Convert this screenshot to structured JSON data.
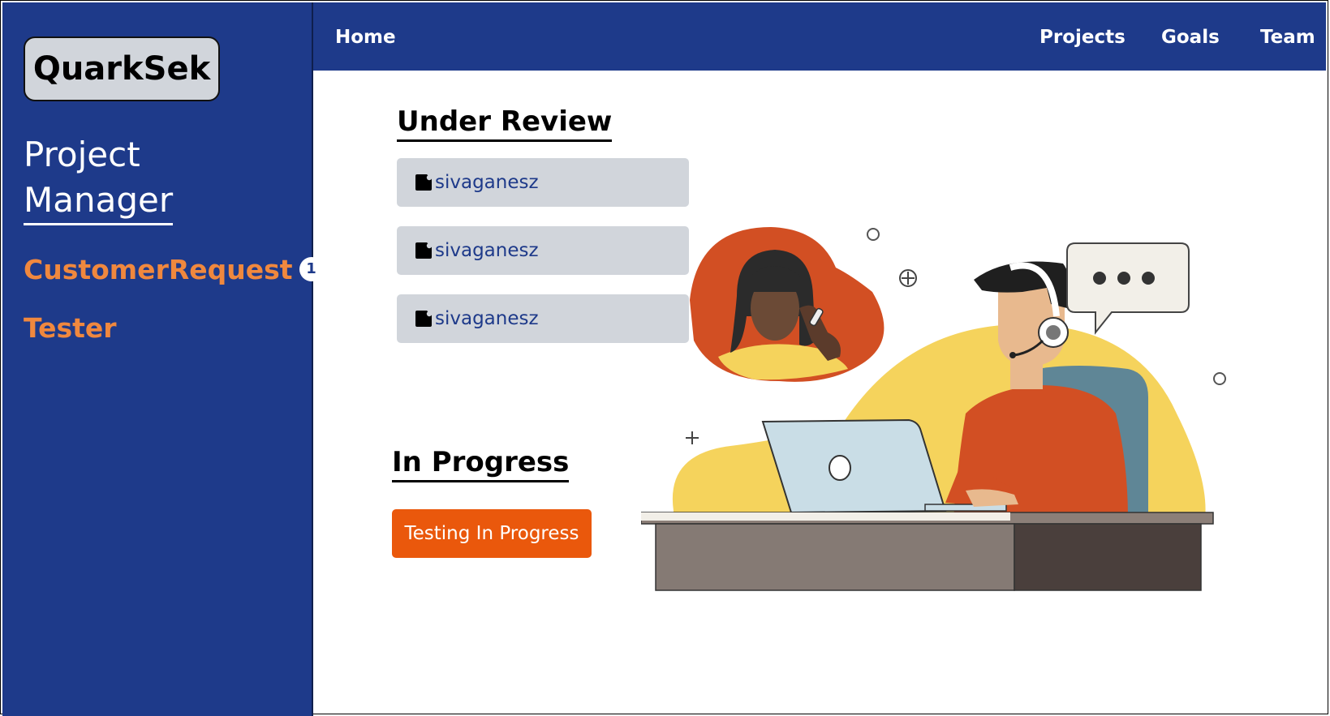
{
  "sidebar": {
    "logo": "QuarkSek",
    "title_line1": "Project",
    "title_line2": "Manager",
    "links": [
      {
        "label": "CustomerRequest",
        "badge": "1"
      },
      {
        "label": "Tester"
      }
    ]
  },
  "topbar": {
    "home": "Home",
    "projects": "Projects",
    "goals": "Goals",
    "team": "Team"
  },
  "under_review": {
    "title": "Under Review",
    "items": [
      {
        "user": "sivaganesz",
        "icon": "file-icon"
      },
      {
        "user": "sivaganesz",
        "icon": "file-icon"
      },
      {
        "user": "sivaganesz",
        "icon": "file-icon"
      }
    ]
  },
  "in_progress": {
    "title": "In Progress",
    "button": "Testing In Progress"
  },
  "colors": {
    "primary": "#1e3a8a",
    "accent_orange": "#f0883e",
    "button_orange": "#ea580c",
    "card_gray": "#d1d5db"
  }
}
